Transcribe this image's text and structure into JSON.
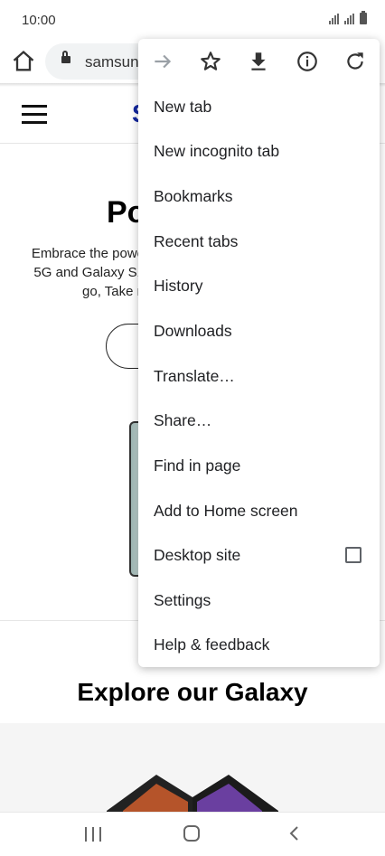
{
  "status_bar": {
    "time": "10:00"
  },
  "browser": {
    "url_text": "samsung.com"
  },
  "page": {
    "hero_title": "Po",
    "hero_lines": [
      "Embrace the powe",
      "5G and Galaxy S1",
      "go, Take n"
    ],
    "explore_title": "Explore our Galaxy"
  },
  "menu": {
    "toolbar": [
      {
        "name": "forward-icon",
        "enabled": false
      },
      {
        "name": "bookmark-star-icon",
        "enabled": true
      },
      {
        "name": "download-icon",
        "enabled": true
      },
      {
        "name": "info-icon",
        "enabled": true
      },
      {
        "name": "refresh-icon",
        "enabled": true
      }
    ],
    "items": [
      {
        "label": "New tab"
      },
      {
        "label": "New incognito tab"
      },
      {
        "label": "Bookmarks"
      },
      {
        "label": "Recent tabs"
      },
      {
        "label": "History"
      },
      {
        "label": "Downloads"
      },
      {
        "label": "Translate…"
      },
      {
        "label": "Share…"
      },
      {
        "label": "Find in page"
      },
      {
        "label": "Add to Home screen"
      },
      {
        "label": "Desktop site",
        "checked": false
      },
      {
        "label": "Settings"
      },
      {
        "label": "Help & feedback"
      }
    ]
  },
  "colors": {
    "samsung_blue": "#1428a0",
    "icon_gray": "#5f6368",
    "disabled_gray": "#9aa0a6"
  }
}
